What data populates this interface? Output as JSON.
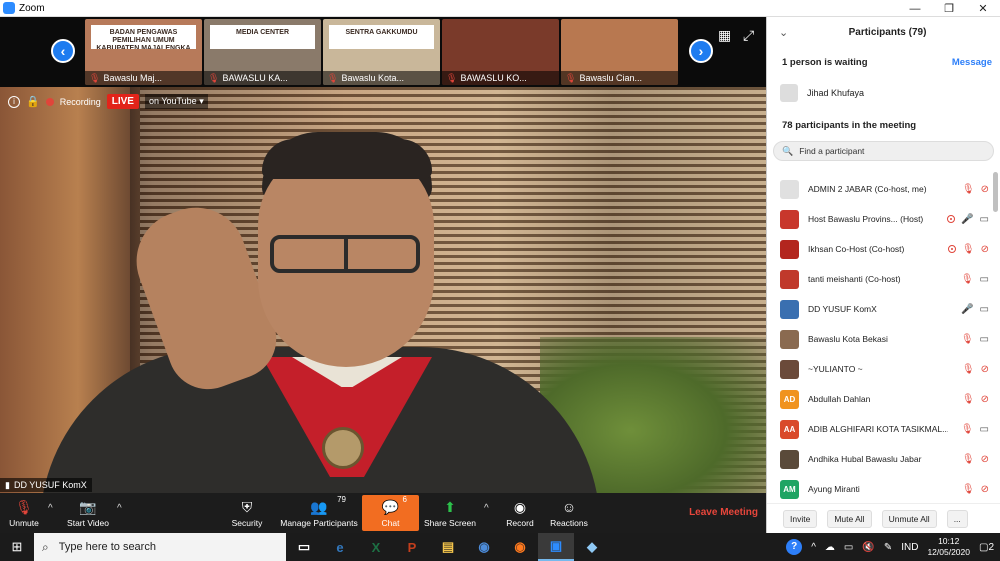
{
  "window": {
    "title": "Zoom",
    "controls": {
      "minimize": "—",
      "maximize": "❐",
      "close": "✕"
    }
  },
  "gallery": {
    "thumbnails": [
      {
        "label": "Bawaslu Maj...",
        "banner": "BADAN PENGAWAS PEMILIHAN UMUM KABUPATEN MAJALENGKA",
        "bg": "#b77a5a"
      },
      {
        "label": "BAWASLU KA...",
        "banner": "MEDIA CENTER",
        "bg": "#8a7a6a"
      },
      {
        "label": "Bawaslu Kota...",
        "banner": "SENTRA GAKKUMDU",
        "bg": "#c9b79a"
      },
      {
        "label": "BAWASLU KO...",
        "banner": "",
        "bg": "#7a3a2a"
      },
      {
        "label": "Bawaslu Cian...",
        "banner": "",
        "bg": "#b87850"
      }
    ],
    "prev_icon": "‹",
    "next_icon": "›"
  },
  "recording": {
    "status": "Recording",
    "live": "LIVE",
    "stream": "on YouTube"
  },
  "speaker": {
    "name": "DD YUSUF KomX"
  },
  "toolbar": {
    "unmute": "Unmute",
    "start_video": "Start Video",
    "security": "Security",
    "manage_participants": "Manage Participants",
    "participants_count": "79",
    "chat": "Chat",
    "chat_count": "6",
    "share_screen": "Share Screen",
    "record": "Record",
    "reactions": "Reactions",
    "leave": "Leave Meeting"
  },
  "participants_panel": {
    "title": "Participants (79)",
    "waiting_text": "1 person is waiting",
    "message": "Message",
    "waiting_person": "Jihad Khufaya",
    "in_meeting": "78 participants in the meeting",
    "search_placeholder": "Find a participant",
    "participants": [
      {
        "name": "ADMIN 2 JABAR (Co-host, me)",
        "avatar": "",
        "color": "#e0e0e0",
        "rec": false,
        "mic_on": false,
        "cam_on": false
      },
      {
        "name": "Host Bawaslu Provins... (Host)",
        "avatar": "",
        "color": "#c8372c",
        "rec": true,
        "mic_on": true,
        "cam_on": true
      },
      {
        "name": "Ikhsan Co-Host (Co-host)",
        "avatar": "",
        "color": "#b3261e",
        "rec": true,
        "mic_on": false,
        "cam_on": false
      },
      {
        "name": "tanti meishanti (Co-host)",
        "avatar": "",
        "color": "#c0392b",
        "rec": false,
        "mic_on": false,
        "cam_on": true
      },
      {
        "name": "DD YUSUF KomX",
        "avatar": "",
        "color": "#3a6fb0",
        "rec": false,
        "mic_on": true,
        "cam_on": true
      },
      {
        "name": " Bawaslu Kota Bekasi",
        "avatar": "",
        "color": "#8a6a50",
        "rec": false,
        "mic_on": false,
        "cam_on": true
      },
      {
        "name": "~YULIANTO ~",
        "avatar": "",
        "color": "#6b4a3a",
        "rec": false,
        "mic_on": false,
        "cam_on": false
      },
      {
        "name": "Abdullah Dahlan",
        "avatar": "AD",
        "color": "#f0931f",
        "rec": false,
        "mic_on": false,
        "cam_on": false
      },
      {
        "name": "ADIB ALGHIFARI KOTA TASIKMAL...",
        "avatar": "AA",
        "color": "#d94a2b",
        "rec": false,
        "mic_on": false,
        "cam_on": true
      },
      {
        "name": "Andhika Hubal Bawaslu Jabar",
        "avatar": "",
        "color": "#5a4a3a",
        "rec": false,
        "mic_on": false,
        "cam_on": false
      },
      {
        "name": "Ayung Miranti",
        "avatar": "AM",
        "color": "#1fa463",
        "rec": false,
        "mic_on": false,
        "cam_on": false
      }
    ],
    "invite": "Invite",
    "mute_all": "Mute All",
    "unmute_all": "Unmute All",
    "more": "..."
  },
  "taskbar": {
    "search_placeholder": "Type here to search",
    "language": "IND",
    "time": "10:12",
    "date": "12/05/2020",
    "notifications": "2",
    "apps": [
      {
        "name": "task-view-icon",
        "glyph": "▭",
        "color": "#ffffff"
      },
      {
        "name": "edge-icon",
        "glyph": "e",
        "color": "#3277bc"
      },
      {
        "name": "excel-icon",
        "glyph": "X",
        "color": "#1d7044"
      },
      {
        "name": "powerpoint-icon",
        "glyph": "P",
        "color": "#c43e1c"
      },
      {
        "name": "file-explorer-icon",
        "glyph": "▤",
        "color": "#f3c44b"
      },
      {
        "name": "chrome-icon",
        "glyph": "◉",
        "color": "#4d8ddb"
      },
      {
        "name": "firefox-icon",
        "glyph": "◉",
        "color": "#ff7a1f"
      },
      {
        "name": "zoom-icon",
        "glyph": "▣",
        "color": "#2d8cff"
      },
      {
        "name": "paint-icon",
        "glyph": "◆",
        "color": "#8fc9f5"
      }
    ]
  }
}
